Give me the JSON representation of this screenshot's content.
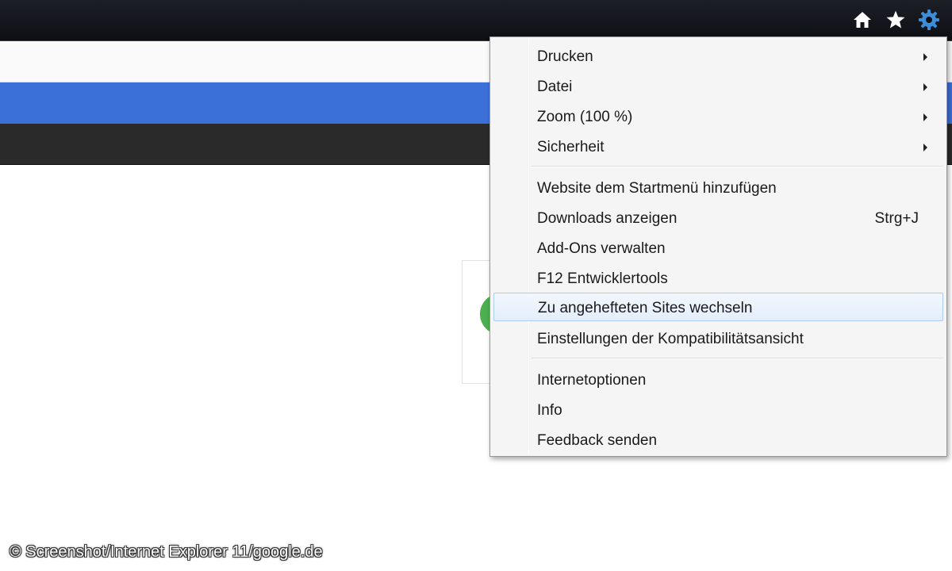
{
  "toolbar": {
    "icons": [
      "home-icon",
      "star-icon",
      "gear-icon"
    ],
    "gear_color": "#3b8ed8"
  },
  "page": {
    "strip_colors": [
      "#fafafa",
      "#3c70d9",
      "#2a2a2a"
    ],
    "logo_color": "#4caf50"
  },
  "menu": {
    "items": [
      {
        "label": "Drucken",
        "submenu": true
      },
      {
        "label": "Datei",
        "submenu": true
      },
      {
        "label": "Zoom (100 %)",
        "submenu": true
      },
      {
        "label": "Sicherheit",
        "submenu": true
      },
      {
        "label": "Website dem Startmenü hinzufügen"
      },
      {
        "label": "Downloads anzeigen",
        "shortcut": "Strg+J"
      },
      {
        "label": "Add-Ons verwalten"
      },
      {
        "label": "F12 Entwicklertools"
      },
      {
        "label": "Zu angehefteten Sites wechseln",
        "highlighted": true
      },
      {
        "label": "Einstellungen der Kompatibilitätsansicht"
      },
      {
        "label": "Internetoptionen"
      },
      {
        "label": "Info"
      },
      {
        "label": "Feedback senden"
      }
    ],
    "highlight_color": "#e3eefb"
  },
  "watermark": "© Screenshot/Internet Explorer 11/google.de"
}
